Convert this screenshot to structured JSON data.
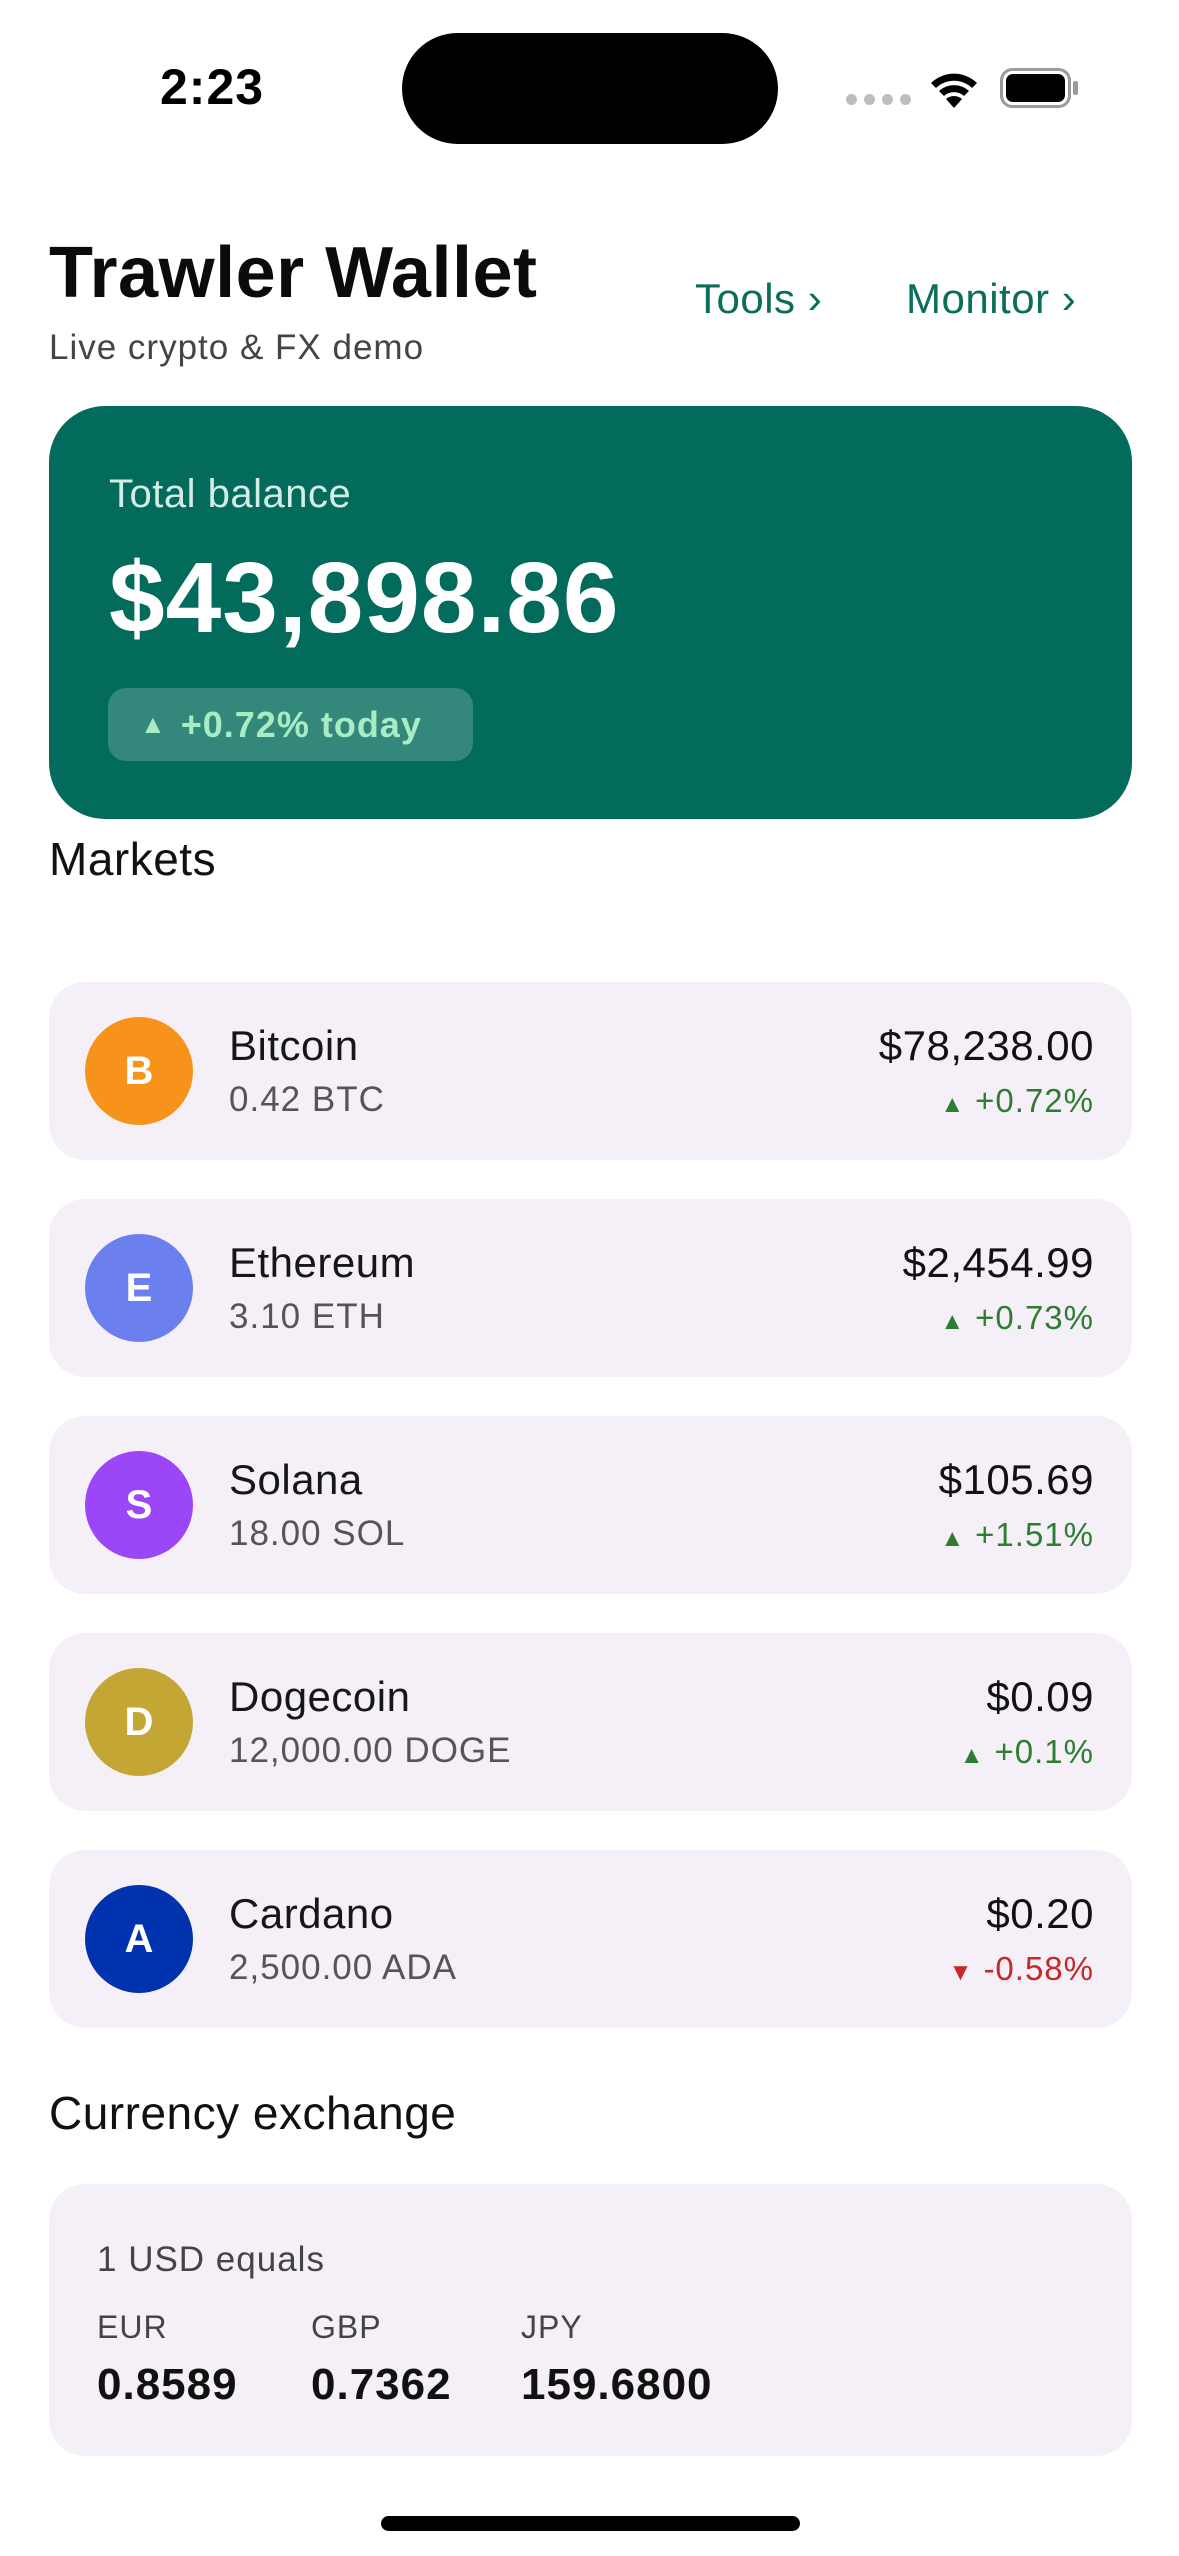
{
  "status": {
    "time": "2:23"
  },
  "header": {
    "title": "Trawler Wallet",
    "subtitle": "Live crypto & FX demo",
    "nav": {
      "tools": "Tools ›",
      "monitor": "Monitor ›"
    }
  },
  "balance": {
    "label": "Total balance",
    "amount": "$43,898.86",
    "change": "+0.72% today",
    "change_direction": "up"
  },
  "markets": {
    "title": "Markets",
    "items": [
      {
        "initial": "B",
        "name": "Bitcoin",
        "holding": "0.42 BTC",
        "price": "$78,238.00",
        "change": "+0.72%",
        "direction": "up",
        "color": "#f7931a"
      },
      {
        "initial": "E",
        "name": "Ethereum",
        "holding": "3.10 ETH",
        "price": "$2,454.99",
        "change": "+0.73%",
        "direction": "up",
        "color": "#6b80ee"
      },
      {
        "initial": "S",
        "name": "Solana",
        "holding": "18.00 SOL",
        "price": "$105.69",
        "change": "+1.51%",
        "direction": "up",
        "color": "#9b46f7"
      },
      {
        "initial": "D",
        "name": "Dogecoin",
        "holding": "12,000.00 DOGE",
        "price": "$0.09",
        "change": "+0.1%",
        "direction": "up",
        "color": "#c3a634"
      },
      {
        "initial": "A",
        "name": "Cardano",
        "holding": "2,500.00 ADA",
        "price": "$0.20",
        "change": "-0.58%",
        "direction": "down",
        "color": "#0033ad"
      }
    ]
  },
  "exchange": {
    "title": "Currency exchange",
    "base": "1 USD equals",
    "rates": [
      {
        "code": "EUR",
        "rate": "0.8589"
      },
      {
        "code": "GBP",
        "rate": "0.7362"
      },
      {
        "code": "JPY",
        "rate": "159.6800"
      }
    ]
  },
  "colors": {
    "accent": "#026b5b",
    "link": "#0b6e5a",
    "up": "#2e7d32",
    "down": "#c62828",
    "row_bg": "#f5f0f8"
  }
}
